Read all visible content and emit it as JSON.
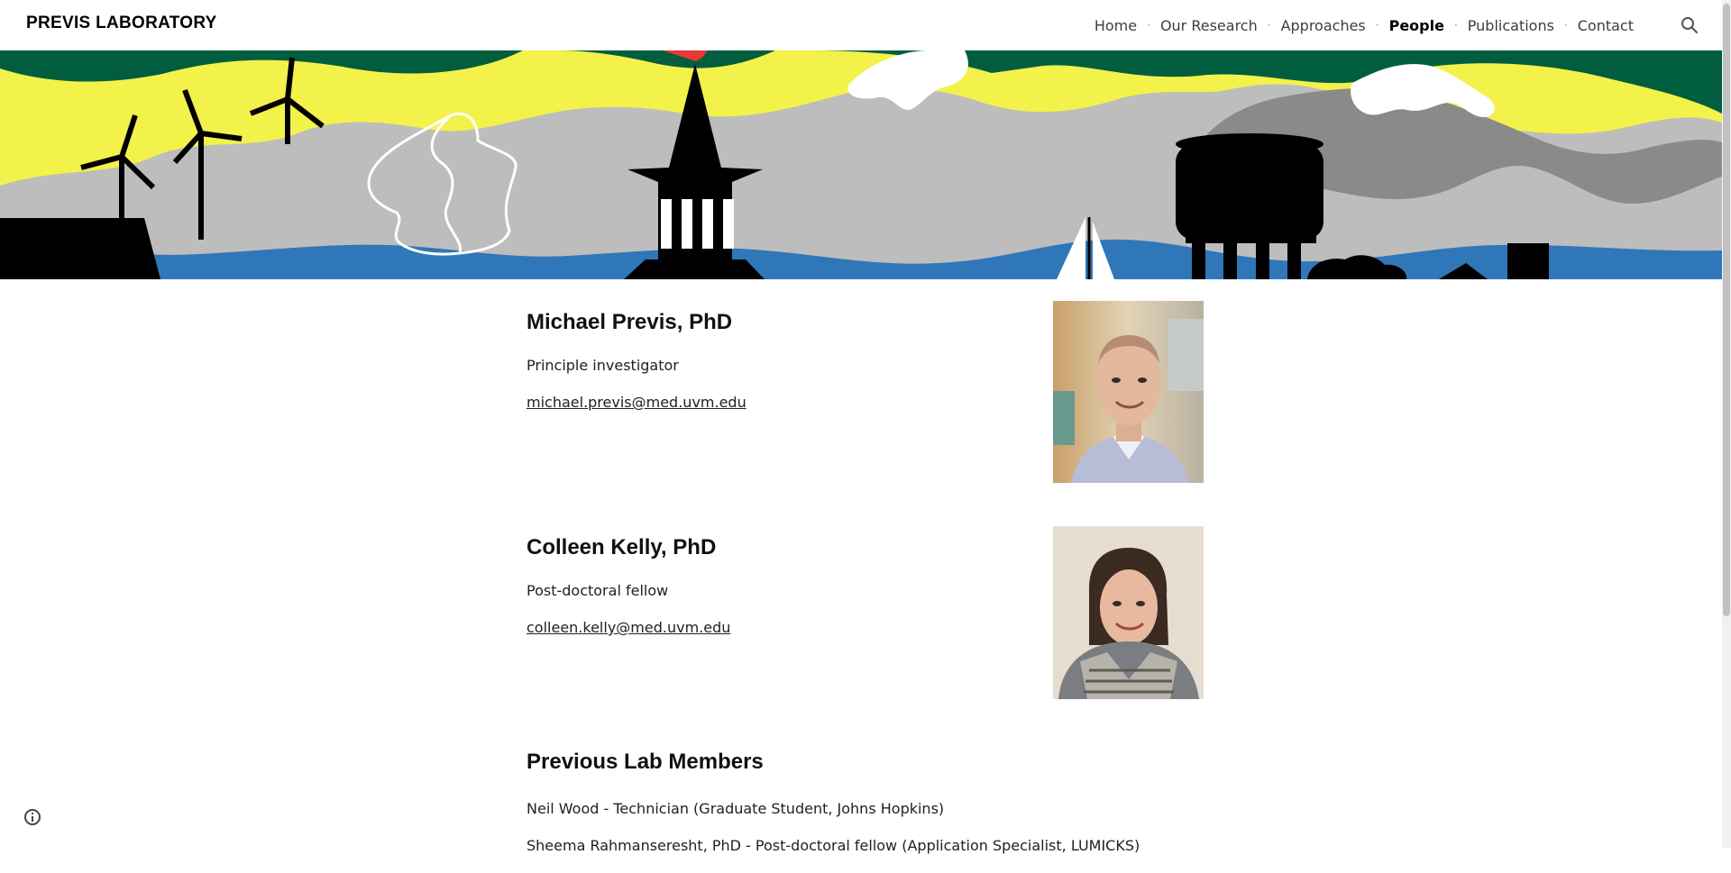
{
  "header": {
    "site_title": "PREVIS LABORATORY",
    "nav": [
      {
        "label": "Home",
        "active": false
      },
      {
        "label": "Our Research",
        "active": false
      },
      {
        "label": "Approaches",
        "active": false
      },
      {
        "label": "People",
        "active": true
      },
      {
        "label": "Publications",
        "active": false
      },
      {
        "label": "Contact",
        "active": false
      }
    ],
    "search_icon": "search-icon"
  },
  "banner": {
    "colors": {
      "sky": "#f2f24a",
      "hills_dark": "#005e3f",
      "mountain": "#bdbdbd",
      "mountain_dark": "#8a8a8a",
      "water": "#2f77b8",
      "silhouette": "#000000"
    }
  },
  "people": [
    {
      "name": "Michael Previs, PhD",
      "role": "Principle investigator",
      "email": "michael.previs@med.uvm.edu"
    },
    {
      "name": "Colleen Kelly, PhD",
      "role": "Post-doctoral fellow",
      "email": "colleen.kelly@med.uvm.edu"
    }
  ],
  "previous": {
    "title": "Previous Lab Members",
    "members": [
      "Neil Wood - Technician (Graduate Student, Johns Hopkins)",
      "Sheema Rahmanseresht, PhD - Post-doctoral fellow (Application Specialist, LUMICKS)"
    ]
  },
  "footer": {
    "info_icon": "info-icon"
  }
}
